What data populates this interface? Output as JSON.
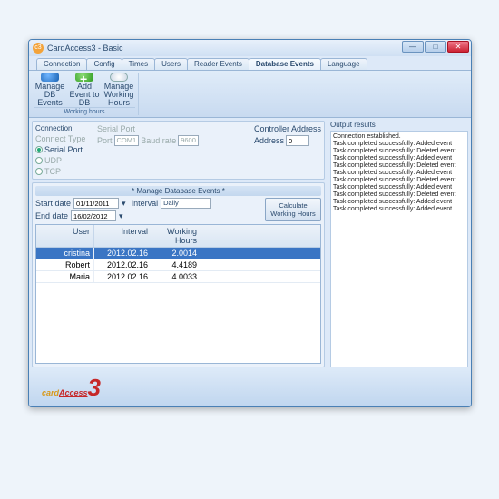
{
  "window": {
    "title": "CardAccess3 - Basic"
  },
  "tabs": [
    "Connection",
    "Config",
    "Times",
    "Users",
    "Reader Events",
    "Database Events",
    "Language"
  ],
  "activeTab": 5,
  "ribbon": {
    "group": "Working hours",
    "buttons": [
      {
        "label": "Manage DB Events"
      },
      {
        "label": "Add Event to DB"
      },
      {
        "label": "Manage Working Hours"
      }
    ]
  },
  "connection": {
    "title": "Connection",
    "typeLabel": "Connect Type",
    "serial": "Serial Port",
    "udp": "UDP",
    "tcp": "TCP",
    "serialGroup": "Serial Port",
    "portLabel": "Port",
    "port": "COM1",
    "baudLabel": "Baud rate",
    "baud": "9600",
    "addrGroup": "Controller Address",
    "addrLabel": "Address",
    "addr": "0"
  },
  "mdb": {
    "title": "*   Manage Database Events   *",
    "startLabel": "Start date",
    "start": "01/11/2011",
    "endLabel": "End date",
    "end": "16/02/2012",
    "intervalLabel": "Interval",
    "interval": "Daily",
    "calcBtn": "Calculate Working Hours",
    "cols": {
      "user": "User",
      "interval": "Interval",
      "hours": "Working Hours"
    },
    "rows": [
      {
        "user": "cristina",
        "interval": "2012.02.16",
        "hours": "2.0014"
      },
      {
        "user": "Robert",
        "interval": "2012.02.16",
        "hours": "4.4189"
      },
      {
        "user": "Maria",
        "interval": "2012.02.16",
        "hours": "4.0033"
      }
    ]
  },
  "output": {
    "title": "Output results",
    "lines": [
      "Connection established.",
      "Task completed successfully: Added event",
      "Task completed successfully: Deleted event",
      "Task completed successfully: Added event",
      "Task completed successfully: Deleted event",
      "Task completed successfully: Added event",
      "Task completed successfully: Deleted event",
      "Task completed successfully: Added event",
      "Task completed successfully: Deleted event",
      "Task completed successfully: Added event",
      "Task completed successfully: Added event"
    ]
  },
  "brand": {
    "a": "card",
    "b": "Access",
    "n": "3"
  }
}
